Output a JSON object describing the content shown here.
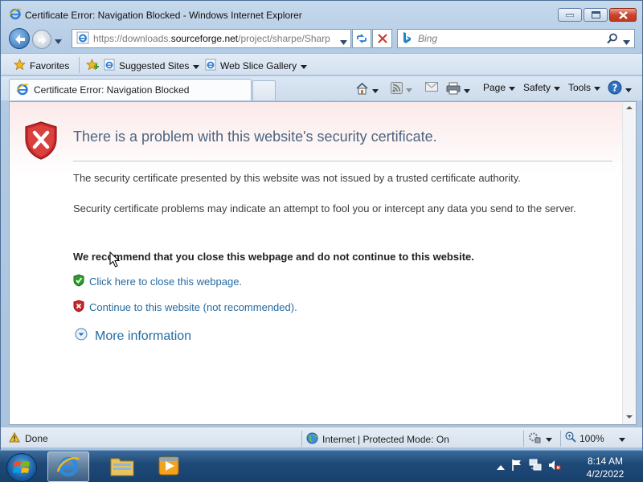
{
  "window": {
    "title": "Certificate Error: Navigation Blocked - Windows Internet Explorer"
  },
  "nav": {
    "address_prefix": "https://downloads.",
    "address_domain": "sourceforge.net",
    "address_suffix": "/project/sharpe/Sharp",
    "search_placeholder": "Bing"
  },
  "favorites_bar": {
    "favorites_label": "Favorites",
    "suggested_sites_label": "Suggested Sites",
    "web_slice_label": "Web Slice Gallery"
  },
  "tab": {
    "label": "Certificate Error: Navigation Blocked"
  },
  "command_bar": {
    "page_label": "Page",
    "safety_label": "Safety",
    "tools_label": "Tools"
  },
  "content": {
    "heading": "There is a problem with this website's security certificate.",
    "paragraph1": "The security certificate presented by this website was not issued by a trusted certificate authority.",
    "paragraph2": "Security certificate problems may indicate an attempt to fool you or intercept any data you send to the server.",
    "recommendation": "We recommend that you close this webpage and do not continue to this website.",
    "close_link": "Click here to close this webpage.",
    "continue_link": "Continue to this website (not recommended).",
    "more_info": "More information"
  },
  "status": {
    "text": "Done",
    "zone": "Internet | Protected Mode: On",
    "zoom": "100%"
  },
  "taskbar": {
    "time": "8:14 AM",
    "date": "4/2/2022"
  },
  "colors": {
    "link": "#246aa1",
    "heading": "#4d6580",
    "shield_red": "#c8262a",
    "shield_green": "#2f9a2f"
  }
}
